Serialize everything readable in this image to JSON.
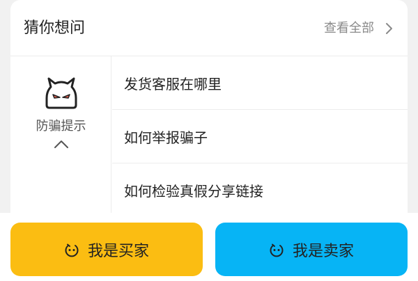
{
  "header": {
    "title": "猜你想问",
    "view_all": "查看全部"
  },
  "fraud_tip": {
    "label": "防骗提示"
  },
  "questions": [
    {
      "text": "发货客服在哪里"
    },
    {
      "text": "如何举报骗子"
    },
    {
      "text": "如何检验真假分享链接"
    }
  ],
  "actions": {
    "buyer_label": "我是买家",
    "seller_label": "我是卖家"
  },
  "colors": {
    "buyer_button": "#fbbd12",
    "seller_button": "#07b4f5",
    "devil_eyes": "#e8604c"
  }
}
